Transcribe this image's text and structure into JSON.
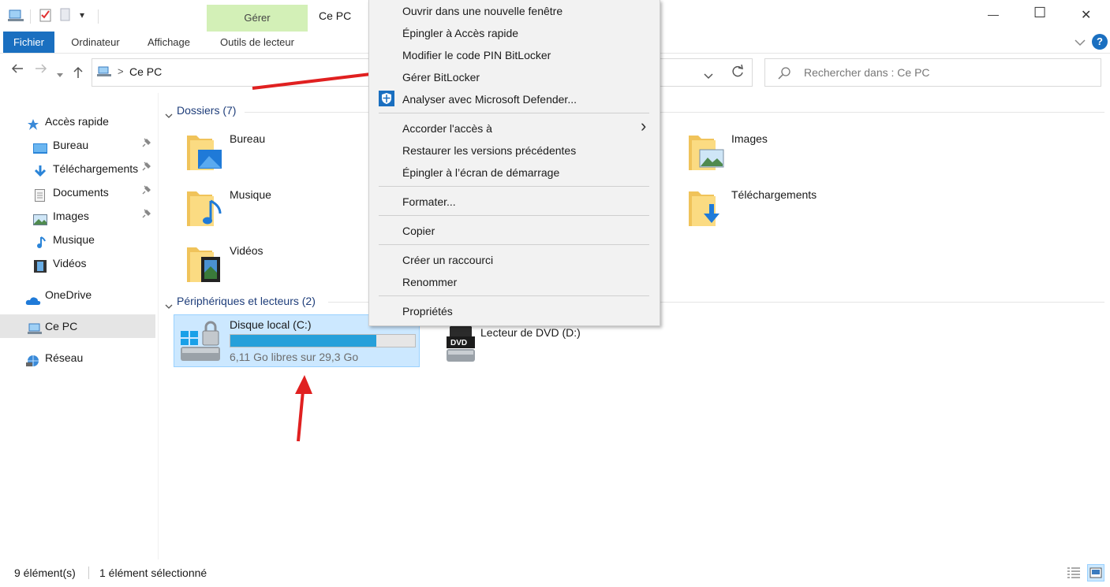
{
  "window": {
    "title": "Ce PC",
    "quick_access_dropdown": "▾",
    "controls": {
      "minimize": "—",
      "maximize": "☐",
      "close": "✕"
    }
  },
  "ribbon": {
    "contextual_group": "Gérer",
    "tabs": [
      "Fichier",
      "Ordinateur",
      "Affichage",
      "Outils de lecteur"
    ],
    "help": "?"
  },
  "address": {
    "path_sep": ">",
    "path": "Ce PC",
    "search_placeholder": "Rechercher dans : Ce PC"
  },
  "sidebar": {
    "items": [
      {
        "label": "Accès rapide",
        "icon": "star-icon",
        "pinned": false
      },
      {
        "label": "Bureau",
        "icon": "desktop-icon",
        "pinned": true
      },
      {
        "label": "Téléchargements",
        "icon": "download-icon",
        "pinned": true
      },
      {
        "label": "Documents",
        "icon": "document-icon",
        "pinned": true
      },
      {
        "label": "Images",
        "icon": "image-icon",
        "pinned": true
      },
      {
        "label": "Musique",
        "icon": "music-icon",
        "pinned": false
      },
      {
        "label": "Vidéos",
        "icon": "video-icon",
        "pinned": false
      },
      {
        "label": "OneDrive",
        "icon": "cloud-icon",
        "pinned": false
      },
      {
        "label": "Ce PC",
        "icon": "computer-icon",
        "pinned": false,
        "selected": true
      },
      {
        "label": "Réseau",
        "icon": "network-icon",
        "pinned": false
      }
    ]
  },
  "content": {
    "folders_header": "Dossiers (7)",
    "folders": [
      {
        "label": "Bureau",
        "icon": "desktop-folder-icon"
      },
      {
        "label": "Images",
        "icon": "pictures-folder-icon"
      },
      {
        "label": "Musique",
        "icon": "music-folder-icon"
      },
      {
        "label": "Téléchargements",
        "icon": "downloads-folder-icon"
      },
      {
        "label": "Vidéos",
        "icon": "videos-folder-icon"
      }
    ],
    "devices_header": "Périphériques et lecteurs (2)",
    "drives": [
      {
        "label": "Disque local (C:)",
        "free": "6,11 Go libres sur 29,3 Go",
        "used_fraction": 0.79,
        "icon": "locked-drive-icon",
        "selected": true
      },
      {
        "label": "Lecteur de DVD (D:)",
        "icon": "dvd-drive-icon",
        "badge": "DVD"
      }
    ]
  },
  "context_menu": {
    "items": [
      "Ouvrir dans une nouvelle fenêtre",
      "Épingler à Accès rapide",
      "Modifier le code PIN BitLocker",
      "Gérer BitLocker",
      "Analyser avec Microsoft Defender...",
      "Accorder l'accès à",
      "Restaurer les versions précédentes",
      "Épingler à l’écran de démarrage",
      "Formater...",
      "Copier",
      "Créer un raccourci",
      "Renommer",
      "Propriétés"
    ],
    "submenu_arrow": "›"
  },
  "status": {
    "count": "9 élément(s)",
    "selected": "1 élément sélectionné"
  },
  "colors": {
    "accent": "#1a6fc0",
    "contextual_tab": "#d3f0b7",
    "selection": "#cce8ff",
    "annotation_arrow": "#e02020",
    "drive_bar": "#26a0da"
  }
}
